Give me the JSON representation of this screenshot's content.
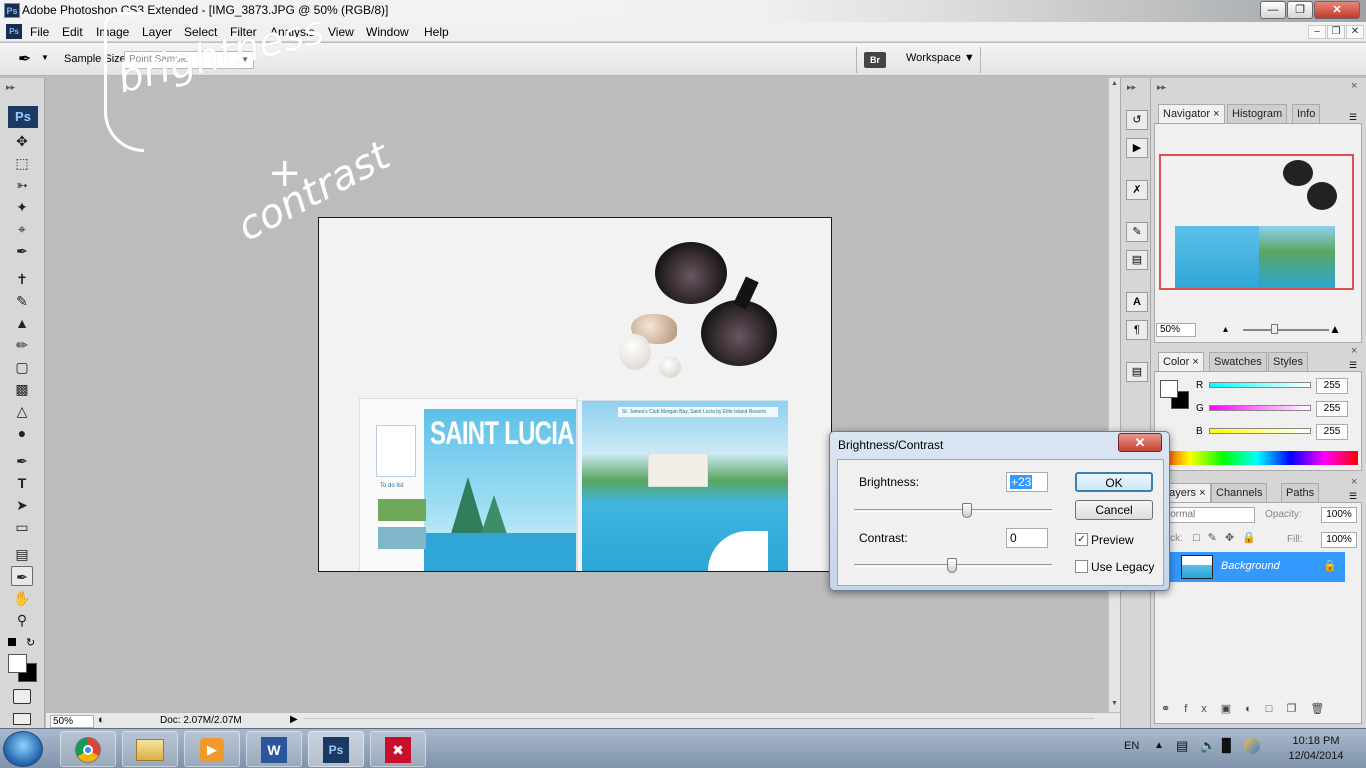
{
  "titlebar": {
    "title": "Adobe Photoshop CS3 Extended - [IMG_3873.JPG @ 50% (RGB/8)]",
    "app_icon": "Ps"
  },
  "menu": {
    "ps_icon": "Ps",
    "items": [
      "File",
      "Edit",
      "Image",
      "Layer",
      "Select",
      "Filter",
      "Analysis",
      "View",
      "Window",
      "Help"
    ]
  },
  "options": {
    "sample_size_label": "Sample Size:",
    "sample_value": "Point Sample",
    "bridge_icon": "Br",
    "workspace_label": "Workspace ▼"
  },
  "toolbox": {
    "ps_logo": "Ps"
  },
  "annotation": {
    "line1": "brightness",
    "line2": "+",
    "line3": "contrast"
  },
  "document": {
    "page_title": "SAINT LUCIA",
    "todo_label": "To do list",
    "right_header": "St. James's Club Morgan Bay, Saint Lucia by Elite Island Resorts"
  },
  "status": {
    "zoom": "50%",
    "doc_size": "Doc: 2.07M/2.07M"
  },
  "navigator": {
    "tabs": [
      "Navigator",
      "Histogram",
      "Info"
    ],
    "zoom": "50%"
  },
  "color_panel": {
    "tabs": [
      "Color",
      "Swatches",
      "Styles"
    ],
    "channels": [
      {
        "label": "R",
        "value": "255"
      },
      {
        "label": "G",
        "value": "255"
      },
      {
        "label": "B",
        "value": "255"
      }
    ]
  },
  "layers_panel": {
    "tabs": [
      "Layers",
      "Channels",
      "Paths"
    ],
    "blend_mode": "Normal",
    "opacity_label": "Opacity:",
    "opacity": "100%",
    "lock_label": "Lock:",
    "fill_label": "Fill:",
    "fill": "100%",
    "layer_name": "Background"
  },
  "dialog": {
    "title": "Brightness/Contrast",
    "brightness_label": "Brightness:",
    "brightness_value": "+23",
    "contrast_label": "Contrast:",
    "contrast_value": "0",
    "ok_label": "OK",
    "cancel_label": "Cancel",
    "preview_label": "Preview",
    "preview_checked": true,
    "legacy_label": "Use Legacy",
    "legacy_checked": false
  },
  "taskbar": {
    "lang": "EN",
    "time": "10:18 PM",
    "date": "12/04/2014",
    "word_icon": "W",
    "ps_icon": "Ps"
  },
  "colors": {
    "accent_blue": "#3399ff",
    "ok_border": "#3c7fb1",
    "close_red": "#c8412f"
  }
}
